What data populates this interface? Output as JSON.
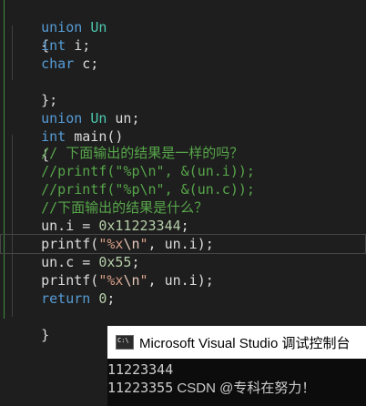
{
  "code": {
    "l1_kw": "union",
    "l1_name": "Un",
    "l2": "{",
    "l3_type": "int",
    "l3_var": "i;",
    "l4_type": "char",
    "l4_var": "c;",
    "l5": "};",
    "l6_kw": "union",
    "l6_type": "Un",
    "l6_var": "un;",
    "l7_type": "int",
    "l7_fn": "main()",
    "l8": "{",
    "l9_comment": "// 下面输出的结果是一样的吗？",
    "l10_comment": "//printf(\"%p\\n\", &(un.i));",
    "l11_comment": "//printf(\"%p\\n\", &(un.c));",
    "l12_comment": "//下面输出的结果是什么？",
    "l13_lhs": "un.i = ",
    "l13_num": "0x11223344",
    "l13_end": ";",
    "l14_fn": "printf(",
    "l14_str1": "\"%x",
    "l14_esc": "\\n",
    "l14_str2": "\"",
    "l14_rest": ", un.i);",
    "l15_lhs": "un.c = ",
    "l15_num": "0x55",
    "l15_end": ";",
    "l16_fn": "printf(",
    "l16_str1": "\"%x",
    "l16_esc": "\\n",
    "l16_str2": "\"",
    "l16_rest": ", un.i);",
    "l17_kw": "return",
    "l17_num": "0",
    "l17_end": ";",
    "l18": "}"
  },
  "console": {
    "title": "Microsoft Visual Studio 调试控制台",
    "icon": "console-app-icon",
    "line1": "11223344",
    "line2": "11223355",
    "watermark": " CSDN @专科在努力！"
  },
  "colors": {
    "editor_bg": "#1e1e1e",
    "keyword": "#569cd6",
    "comment": "#57a64a",
    "number": "#b5cea8",
    "string": "#d69d85",
    "console_bg": "#0c0c0c"
  }
}
